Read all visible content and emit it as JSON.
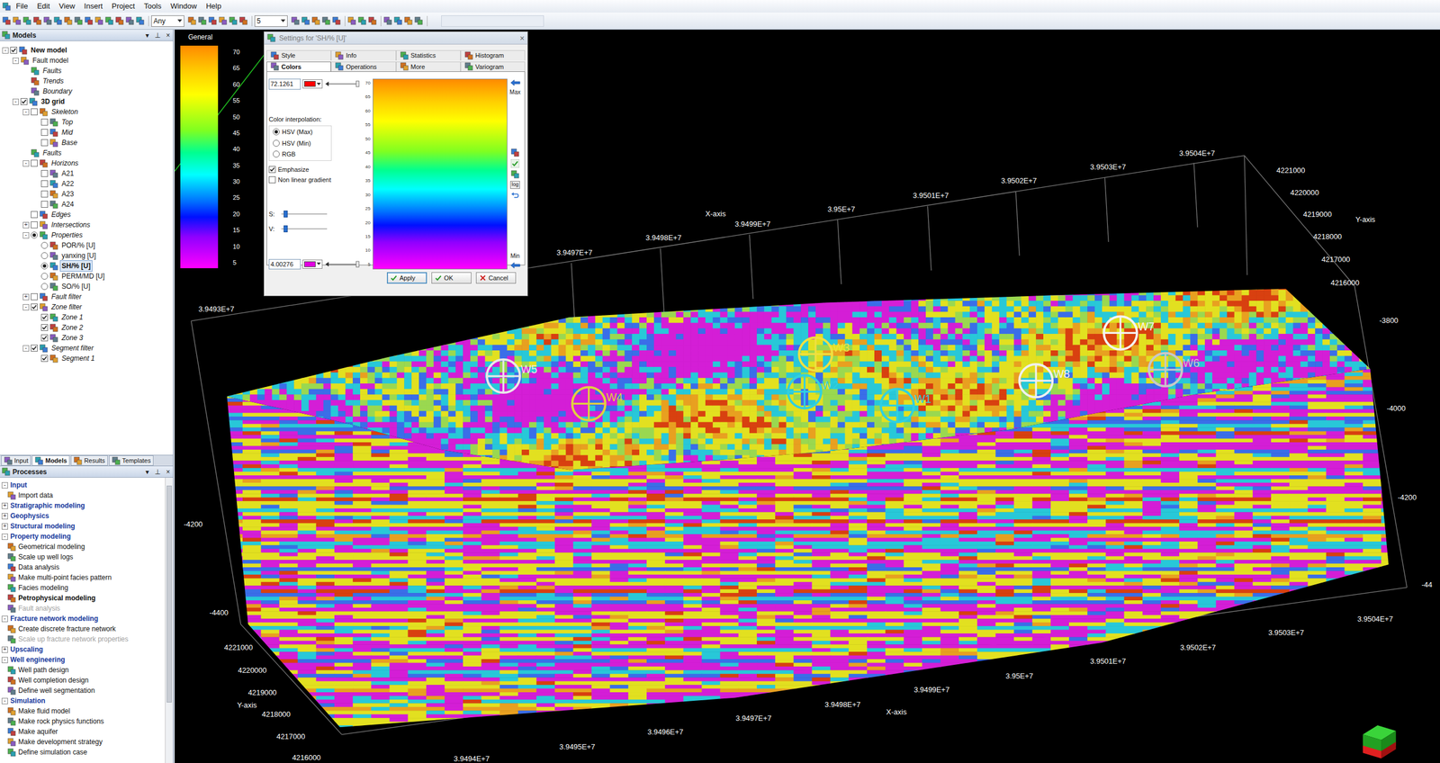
{
  "menu": [
    "File",
    "Edit",
    "View",
    "Insert",
    "Project",
    "Tools",
    "Window",
    "Help"
  ],
  "toolbar": {
    "filter": "Any",
    "count": "5"
  },
  "models_panel": {
    "title": "Models",
    "controls": [
      "▾",
      "⊥",
      "×"
    ],
    "tree": [
      {
        "label": "New model",
        "level": 0,
        "expander": "-",
        "kind": "check",
        "checked": true,
        "selected": false,
        "bold": true,
        "italic": false
      },
      {
        "label": "Fault model",
        "level": 1,
        "expander": "-",
        "kind": "none",
        "checked": false,
        "selected": false,
        "bold": false,
        "italic": false
      },
      {
        "label": "Faults",
        "level": 2,
        "expander": "",
        "kind": "none",
        "checked": false,
        "selected": false,
        "bold": false,
        "italic": true
      },
      {
        "label": "Trends",
        "level": 2,
        "expander": "",
        "kind": "none",
        "checked": false,
        "selected": false,
        "bold": false,
        "italic": true
      },
      {
        "label": "Boundary",
        "level": 2,
        "expander": "",
        "kind": "none",
        "checked": false,
        "selected": false,
        "bold": false,
        "italic": true
      },
      {
        "label": "3D grid",
        "level": 1,
        "expander": "-",
        "kind": "check",
        "checked": true,
        "selected": false,
        "bold": true,
        "italic": false
      },
      {
        "label": "Skeleton",
        "level": 2,
        "expander": "-",
        "kind": "check",
        "checked": false,
        "selected": false,
        "bold": false,
        "italic": true
      },
      {
        "label": "Top",
        "level": 3,
        "expander": "",
        "kind": "check",
        "checked": false,
        "selected": false,
        "bold": false,
        "italic": true
      },
      {
        "label": "Mid",
        "level": 3,
        "expander": "",
        "kind": "check",
        "checked": false,
        "selected": false,
        "bold": false,
        "italic": true
      },
      {
        "label": "Base",
        "level": 3,
        "expander": "",
        "kind": "check",
        "checked": false,
        "selected": false,
        "bold": false,
        "italic": true
      },
      {
        "label": "Faults",
        "level": 2,
        "expander": "",
        "kind": "none",
        "checked": false,
        "selected": false,
        "bold": false,
        "italic": true
      },
      {
        "label": "Horizons",
        "level": 2,
        "expander": "-",
        "kind": "check",
        "checked": false,
        "selected": false,
        "bold": false,
        "italic": true
      },
      {
        "label": "A21",
        "level": 3,
        "expander": "",
        "kind": "check",
        "checked": false,
        "selected": false,
        "bold": false,
        "italic": false
      },
      {
        "label": "A22",
        "level": 3,
        "expander": "",
        "kind": "check",
        "checked": false,
        "selected": false,
        "bold": false,
        "italic": false
      },
      {
        "label": "A23",
        "level": 3,
        "expander": "",
        "kind": "check",
        "checked": false,
        "selected": false,
        "bold": false,
        "italic": false
      },
      {
        "label": "A24",
        "level": 3,
        "expander": "",
        "kind": "check",
        "checked": false,
        "selected": false,
        "bold": false,
        "italic": false
      },
      {
        "label": "Edges",
        "level": 2,
        "expander": "",
        "kind": "check",
        "checked": false,
        "selected": false,
        "bold": false,
        "italic": true
      },
      {
        "label": "Intersections",
        "level": 2,
        "expander": "+",
        "kind": "check",
        "checked": false,
        "selected": false,
        "bold": false,
        "italic": true
      },
      {
        "label": "Properties",
        "level": 2,
        "expander": "-",
        "kind": "radio",
        "checked": true,
        "selected": false,
        "bold": false,
        "italic": true
      },
      {
        "label": "POR/% [U]",
        "level": 3,
        "expander": "",
        "kind": "radio",
        "checked": false,
        "selected": false,
        "bold": false,
        "italic": false
      },
      {
        "label": "yanxing [U]",
        "level": 3,
        "expander": "",
        "kind": "radio",
        "checked": false,
        "selected": false,
        "bold": false,
        "italic": false
      },
      {
        "label": "SH/% [U]",
        "level": 3,
        "expander": "",
        "kind": "radio",
        "checked": true,
        "selected": true,
        "bold": true,
        "italic": false
      },
      {
        "label": "PERM/MD [U]",
        "level": 3,
        "expander": "",
        "kind": "radio",
        "checked": false,
        "selected": false,
        "bold": false,
        "italic": false
      },
      {
        "label": "SO/% [U]",
        "level": 3,
        "expander": "",
        "kind": "radio",
        "checked": false,
        "selected": false,
        "bold": false,
        "italic": false
      },
      {
        "label": "Fault filter",
        "level": 2,
        "expander": "+",
        "kind": "check",
        "checked": false,
        "selected": false,
        "bold": false,
        "italic": true
      },
      {
        "label": "Zone filter",
        "level": 2,
        "expander": "-",
        "kind": "check",
        "checked": true,
        "selected": false,
        "bold": false,
        "italic": true
      },
      {
        "label": "Zone 1",
        "level": 3,
        "expander": "",
        "kind": "check",
        "checked": true,
        "selected": false,
        "bold": false,
        "italic": true
      },
      {
        "label": "Zone 2",
        "level": 3,
        "expander": "",
        "kind": "check",
        "checked": true,
        "selected": false,
        "bold": false,
        "italic": true
      },
      {
        "label": "Zone 3",
        "level": 3,
        "expander": "",
        "kind": "check",
        "checked": true,
        "selected": false,
        "bold": false,
        "italic": true
      },
      {
        "label": "Segment filter",
        "level": 2,
        "expander": "-",
        "kind": "check",
        "checked": true,
        "selected": false,
        "bold": false,
        "italic": true
      },
      {
        "label": "Segment 1",
        "level": 3,
        "expander": "",
        "kind": "check",
        "checked": true,
        "selected": false,
        "bold": false,
        "italic": true
      }
    ]
  },
  "panel_tabs": [
    {
      "label": "Input",
      "selected": false
    },
    {
      "label": "Models",
      "selected": true
    },
    {
      "label": "Results",
      "selected": false
    },
    {
      "label": "Templates",
      "selected": false
    }
  ],
  "processes_panel": {
    "title": "Processes",
    "controls": [
      "▾",
      "⊥",
      "×"
    ],
    "items": [
      {
        "label": "Input",
        "kind": "header",
        "expander": "-",
        "bold": true,
        "disabled": false
      },
      {
        "label": "Import data",
        "kind": "item",
        "expander": "",
        "bold": false,
        "disabled": false
      },
      {
        "label": "Stratigraphic modeling",
        "kind": "header",
        "expander": "+",
        "bold": true,
        "disabled": false
      },
      {
        "label": "Geophysics",
        "kind": "header",
        "expander": "+",
        "bold": true,
        "disabled": false
      },
      {
        "label": "Structural modeling",
        "kind": "header",
        "expander": "+",
        "bold": true,
        "disabled": false
      },
      {
        "label": "Property modeling",
        "kind": "header",
        "expander": "-",
        "bold": true,
        "disabled": false
      },
      {
        "label": "Geometrical modeling",
        "kind": "item",
        "expander": "",
        "bold": false,
        "disabled": false
      },
      {
        "label": "Scale up well logs",
        "kind": "item",
        "expander": "",
        "bold": false,
        "disabled": false
      },
      {
        "label": "Data analysis",
        "kind": "item",
        "expander": "",
        "bold": false,
        "disabled": false
      },
      {
        "label": "Make multi-point facies pattern",
        "kind": "item",
        "expander": "",
        "bold": false,
        "disabled": false
      },
      {
        "label": "Facies modeling",
        "kind": "item",
        "expander": "",
        "bold": false,
        "disabled": false
      },
      {
        "label": "Petrophysical modeling",
        "kind": "item",
        "expander": "",
        "bold": true,
        "disabled": false
      },
      {
        "label": "Fault analysis",
        "kind": "item",
        "expander": "",
        "bold": false,
        "disabled": true
      },
      {
        "label": "Fracture network modeling",
        "kind": "header",
        "expander": "-",
        "bold": true,
        "disabled": false
      },
      {
        "label": "Create discrete fracture network",
        "kind": "item",
        "expander": "",
        "bold": false,
        "disabled": false
      },
      {
        "label": "Scale up fracture network properties",
        "kind": "item",
        "expander": "",
        "bold": false,
        "disabled": true
      },
      {
        "label": "Upscaling",
        "kind": "header",
        "expander": "+",
        "bold": true,
        "disabled": false
      },
      {
        "label": "Well engineering",
        "kind": "header",
        "expander": "-",
        "bold": true,
        "disabled": false
      },
      {
        "label": "Well path design",
        "kind": "item",
        "expander": "",
        "bold": false,
        "disabled": false
      },
      {
        "label": "Well completion design",
        "kind": "item",
        "expander": "",
        "bold": false,
        "disabled": false
      },
      {
        "label": "Define well segmentation",
        "kind": "item",
        "expander": "",
        "bold": false,
        "disabled": false
      },
      {
        "label": "Simulation",
        "kind": "header",
        "expander": "-",
        "bold": true,
        "disabled": false
      },
      {
        "label": "Make fluid model",
        "kind": "item",
        "expander": "",
        "bold": false,
        "disabled": false
      },
      {
        "label": "Make rock physics functions",
        "kind": "item",
        "expander": "",
        "bold": false,
        "disabled": false
      },
      {
        "label": "Make aquifer",
        "kind": "item",
        "expander": "",
        "bold": false,
        "disabled": false
      },
      {
        "label": "Make development strategy",
        "kind": "item",
        "expander": "",
        "bold": false,
        "disabled": false
      },
      {
        "label": "Define simulation case",
        "kind": "item",
        "expander": "",
        "bold": false,
        "disabled": false
      }
    ]
  },
  "legend": {
    "title": "General",
    "ticks": [
      "70",
      "65",
      "60",
      "55",
      "50",
      "45",
      "40",
      "35",
      "30",
      "25",
      "20",
      "15",
      "10",
      "5"
    ]
  },
  "dialog": {
    "title": "Settings for 'SH/% [U]'",
    "close": "×",
    "tabs_row1": [
      {
        "label": "Style",
        "selected": false
      },
      {
        "label": "Info",
        "selected": false
      },
      {
        "label": "Statistics",
        "selected": false
      },
      {
        "label": "Histogram",
        "selected": false
      }
    ],
    "tabs_row2": [
      {
        "label": "Colors",
        "selected": true
      },
      {
        "label": "Operations",
        "selected": false
      },
      {
        "label": "More",
        "selected": false
      },
      {
        "label": "Variogram",
        "selected": false
      }
    ],
    "max": {
      "value": "72.1261",
      "color": "#ff0000"
    },
    "min": {
      "value": "4.00276",
      "color": "#e000e0"
    },
    "interpolation_label": "Color interpolation:",
    "interpolation": [
      {
        "label": "HSV (Max)",
        "selected": true
      },
      {
        "label": "HSV (Min)",
        "selected": false
      },
      {
        "label": "RGB",
        "selected": false
      }
    ],
    "checks": [
      {
        "label": "Emphasize",
        "checked": true
      },
      {
        "label": "Non linear gradient",
        "checked": false
      }
    ],
    "sliders": [
      {
        "label": "S:",
        "level": 0.05
      },
      {
        "label": "V:",
        "level": 0.05
      }
    ],
    "scale": [
      "70",
      "65",
      "60",
      "55",
      "50",
      "45",
      "40",
      "35",
      "30",
      "25",
      "20",
      "15",
      "10",
      "5"
    ],
    "max_label": "Max",
    "min_label": "Min",
    "log_button": "log",
    "buttons": [
      {
        "label": "Apply",
        "focused": true
      },
      {
        "label": "OK",
        "focused": false
      },
      {
        "label": "Cancel",
        "focused": false
      }
    ]
  },
  "viewport": {
    "axis_labels": [
      "3.9493E+7",
      "3.9497E+7",
      "3.9498E+7",
      "X-axis",
      "3.9499E+7",
      "3.95E+7",
      "3.9501E+7",
      "3.9502E+7",
      "3.9503E+7",
      "3.9504E+7",
      "4221000",
      "4220000",
      "Y-axis",
      "4219000",
      "4218000",
      "4217000",
      "4216000",
      "-3800",
      "-4000",
      "-4200",
      "-44",
      "-4200",
      "-4400",
      "4221000",
      "4220000",
      "Y-axis",
      "4219000",
      "4218000",
      "4217000",
      "4216000",
      "3.9494E+7",
      "3.9495E+7",
      "3.9496E+7",
      "3.9497E+7",
      "3.9498E+7",
      "X-axis",
      "3.9499E+7",
      "3.95E+7",
      "3.9501E+7",
      "3.9502E+7",
      "3.9503E+7",
      "3.9504E+7"
    ],
    "wells": [
      {
        "label": "W5",
        "color": "#e8e8e8"
      },
      {
        "label": "W4",
        "color": "#e0d040"
      },
      {
        "label": "W3",
        "color": "#f0e040"
      },
      {
        "label": "W2",
        "color": "#30d0e0"
      },
      {
        "label": "W1",
        "color": "#30d0e0"
      },
      {
        "label": "W8",
        "color": "#f0f0f0"
      },
      {
        "label": "W7",
        "color": "#f4f4f4"
      },
      {
        "label": "W6",
        "color": "#c8c8c8"
      }
    ]
  }
}
